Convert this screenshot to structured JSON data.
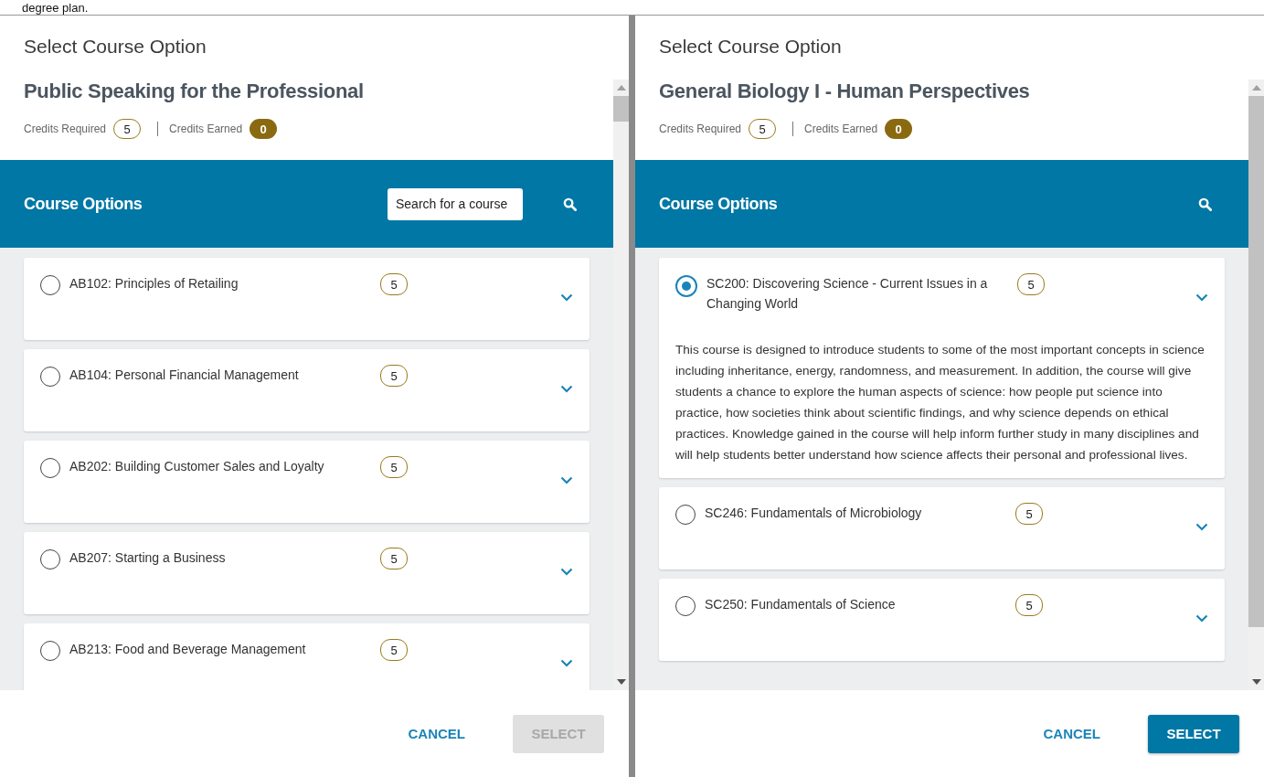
{
  "background_text": "degree plan.",
  "dialogs": [
    {
      "title": "Select Course Option",
      "course_name": "Public Speaking for the Professional",
      "credits_required_label": "Credits Required",
      "credits_required": "5",
      "credits_earned_label": "Credits Earned",
      "credits_earned": "0",
      "options_title": "Course Options",
      "search_placeholder": "Search for a course",
      "courses": [
        {
          "name": "AB102: Principles of Retailing",
          "credits": "5",
          "selected": false
        },
        {
          "name": "AB104: Personal Financial Management",
          "credits": "5",
          "selected": false
        },
        {
          "name": "AB202: Building Customer Sales and Loyalty",
          "credits": "5",
          "selected": false
        },
        {
          "name": "AB207: Starting a Business",
          "credits": "5",
          "selected": false
        },
        {
          "name": "AB213: Food and Beverage Management",
          "credits": "5",
          "selected": false
        }
      ],
      "cancel": "CANCEL",
      "select": {
        "label": "SELECT",
        "disabled": true
      }
    },
    {
      "title": "Select Course Option",
      "course_name": "General Biology I - Human Perspectives",
      "credits_required_label": "Credits Required",
      "credits_required": "5",
      "credits_earned_label": "Credits Earned",
      "credits_earned": "0",
      "options_title": "Course Options",
      "courses": [
        {
          "name": "SC200: Discovering Science - Current Issues in a Changing World",
          "credits": "5",
          "selected": true,
          "description": "This course is designed to introduce students to some of the most important concepts in science including inheritance, energy, randomness, and measurement. In addition, the course will give students a chance to explore the human aspects of science: how people put science into practice, how societies think about scientific findings, and why science depends on ethical practices. Knowledge gained in the course will help inform further study in many disciplines and will help students better understand how science affects their personal and professional lives."
        },
        {
          "name": "SC246: Fundamentals of Microbiology",
          "credits": "5",
          "selected": false
        },
        {
          "name": "SC250: Fundamentals of Science",
          "credits": "5",
          "selected": false
        }
      ],
      "cancel": "CANCEL",
      "select": {
        "label": "SELECT",
        "disabled": false
      }
    }
  ]
}
